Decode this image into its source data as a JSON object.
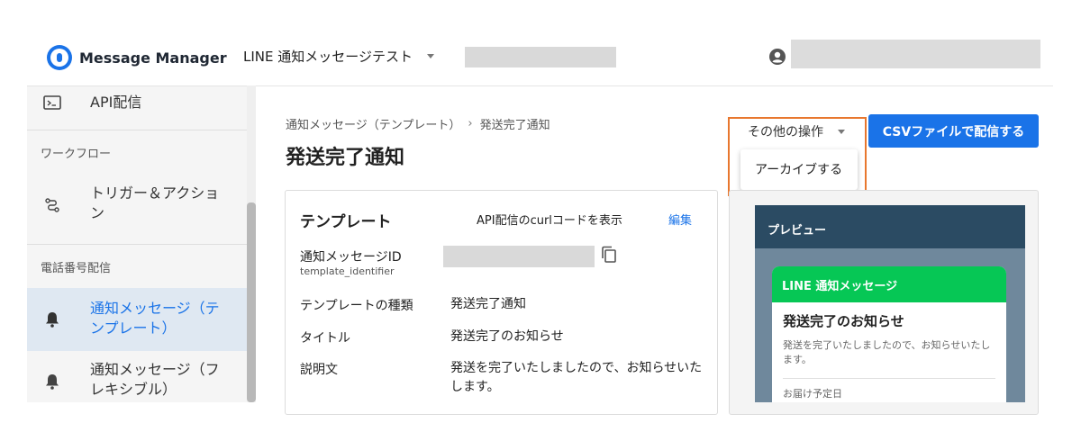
{
  "header": {
    "app_name": "Message Manager",
    "project_name": "LINE 通知メッセージテスト"
  },
  "sidebar": {
    "items": [
      {
        "label": "API配信",
        "icon": "terminal-icon"
      },
      {
        "section": "ワークフロー"
      },
      {
        "label": "トリガー＆アクショ\nン",
        "icon": "route-icon"
      },
      {
        "section": "電話番号配信"
      },
      {
        "label": "通知メッセージ（テ\nンプレート）",
        "icon": "bell-icon",
        "active": true
      },
      {
        "label": "通知メッセージ（フ\nレキシブル）",
        "icon": "bell-icon"
      }
    ]
  },
  "breadcrumb": {
    "parent": "通知メッセージ（テンプレート）",
    "separator": "›",
    "current": "発送完了通知"
  },
  "page_title": "発送完了通知",
  "actions": {
    "other_ops_label": "その他の操作",
    "archive_label": "アーカイブする",
    "csv_label": "CSVファイルで配信する"
  },
  "template_card": {
    "title": "テンプレート",
    "curl_link": "API配信のcurlコードを表示",
    "edit_link": "編集",
    "rows": {
      "id_label": "通知メッセージID",
      "id_sub": "template_identifier",
      "type_label": "テンプレートの種類",
      "type_value": "発送完了通知",
      "title_label": "タイトル",
      "title_value": "発送完了のお知らせ",
      "desc_label": "説明文",
      "desc_value": "発送を完了いたしましたので、お知らせいたします。"
    }
  },
  "preview": {
    "header": "プレビュー",
    "message_header": "LINE 通知メッセージ",
    "message_title": "発送完了のお知らせ",
    "message_body": "発送を完了いたしましたので、お知らせいたします。",
    "delivery_label": "お届け予定日"
  },
  "colors": {
    "accent": "#1a73e8",
    "line_green": "#06c755",
    "highlight": "#e8772e",
    "preview_header": "#2b4b63"
  }
}
